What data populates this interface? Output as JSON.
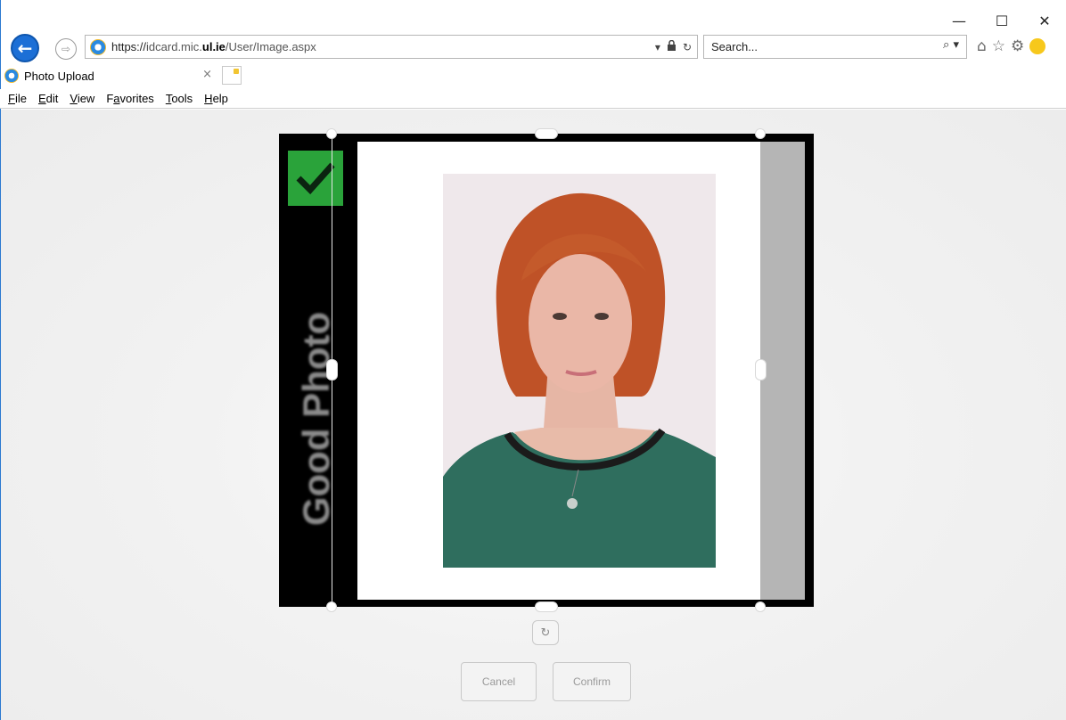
{
  "window": {
    "minimize_glyph": "—",
    "maximize_glyph": "☐",
    "close_glyph": "✕"
  },
  "address_bar": {
    "url_protocol": "https://",
    "url_host_prefix": "idcard.mic.",
    "url_host_bold": "ul.ie",
    "url_path": "/User/Image.aspx",
    "dropdown_glyph": "▾",
    "lock_glyph": "🔒",
    "refresh_glyph": "↻"
  },
  "search": {
    "placeholder": "Search...",
    "search_glyph": "⌕ ▾"
  },
  "toolbar_icons": {
    "home_glyph": "⌂",
    "favorites_glyph": "☆",
    "settings_glyph": "⚙"
  },
  "tab": {
    "title": "Photo Upload",
    "close_glyph": "×"
  },
  "menu": [
    {
      "acc": "F",
      "rest": "ile"
    },
    {
      "acc": "E",
      "rest": "dit"
    },
    {
      "acc": "V",
      "rest": "iew"
    },
    {
      "pre": "F",
      "acc": "a",
      "rest": "vorites"
    },
    {
      "acc": "T",
      "rest": "ools"
    },
    {
      "acc": "H",
      "rest": "elp"
    }
  ],
  "cropper": {
    "sample_label": "Good Photo",
    "check_color": "#2aa33a",
    "shirt_color": "#2f6e5e",
    "hair_color": "#c4552a"
  },
  "controls": {
    "rotate_glyph": "↻",
    "cancel_label": "Cancel",
    "confirm_label": "Confirm"
  }
}
